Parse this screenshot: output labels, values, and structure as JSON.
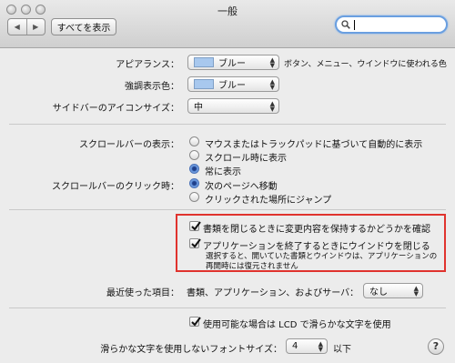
{
  "window": {
    "title": "一般"
  },
  "toolbar": {
    "back_icon": "◀",
    "forward_icon": "▶",
    "show_all_label": "すべてを表示",
    "search_value": ""
  },
  "appearance": {
    "label": "アピアランス：",
    "value": "ブルー",
    "description": "ボタン、メニュー、ウインドウに使われる色"
  },
  "highlight": {
    "label": "強調表示色：",
    "value": "ブルー"
  },
  "sidebar_icon_size": {
    "label": "サイドバーのアイコンサイズ：",
    "value": "中"
  },
  "show_scroll_bars": {
    "label": "スクロールバーの表示：",
    "options": [
      {
        "label": "マウスまたはトラックパッドに基づいて自動的に表示",
        "selected": false
      },
      {
        "label": "スクロール時に表示",
        "selected": false
      },
      {
        "label": "常に表示",
        "selected": true
      }
    ]
  },
  "click_scroll_bar": {
    "label": "スクロールバーのクリック時：",
    "options": [
      {
        "label": "次のページへ移動",
        "selected": true
      },
      {
        "label": "クリックされた場所にジャンプ",
        "selected": false
      }
    ]
  },
  "ask_keep_changes": {
    "label": "書類を閉じるときに変更内容を保持するかどうかを確認",
    "checked": true
  },
  "close_windows_on_quit": {
    "label": "アプリケーションを終了するときにウインドウを閉じる",
    "checked": true
  },
  "close_windows_note": {
    "line1": "選択すると、開いていた書類とウインドウは、アプリケーションの",
    "line2": "再開時には復元されません"
  },
  "recent_items": {
    "label": "最近使った項目：",
    "description": "書類、アプリケーション、およびサーバ：",
    "value": "なし"
  },
  "lcd_smoothing": {
    "label": "使用可能な場合は LCD で滑らかな文字を使用",
    "checked": true
  },
  "font_smoothing": {
    "label": "滑らかな文字を使用しないフォントサイズ：",
    "value": "4",
    "suffix": "以下"
  },
  "help": {
    "label": "?"
  }
}
